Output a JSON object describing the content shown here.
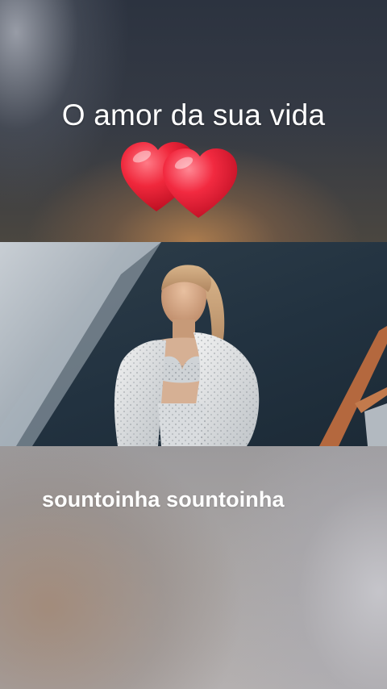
{
  "overlay": {
    "headline": "O amor da sua vida",
    "hearts_emoji": "two-hearts-icon",
    "caption": "sountoinha sountoinha"
  },
  "colors": {
    "heart_red": "#e8283c",
    "text_white": "#ffffff"
  }
}
